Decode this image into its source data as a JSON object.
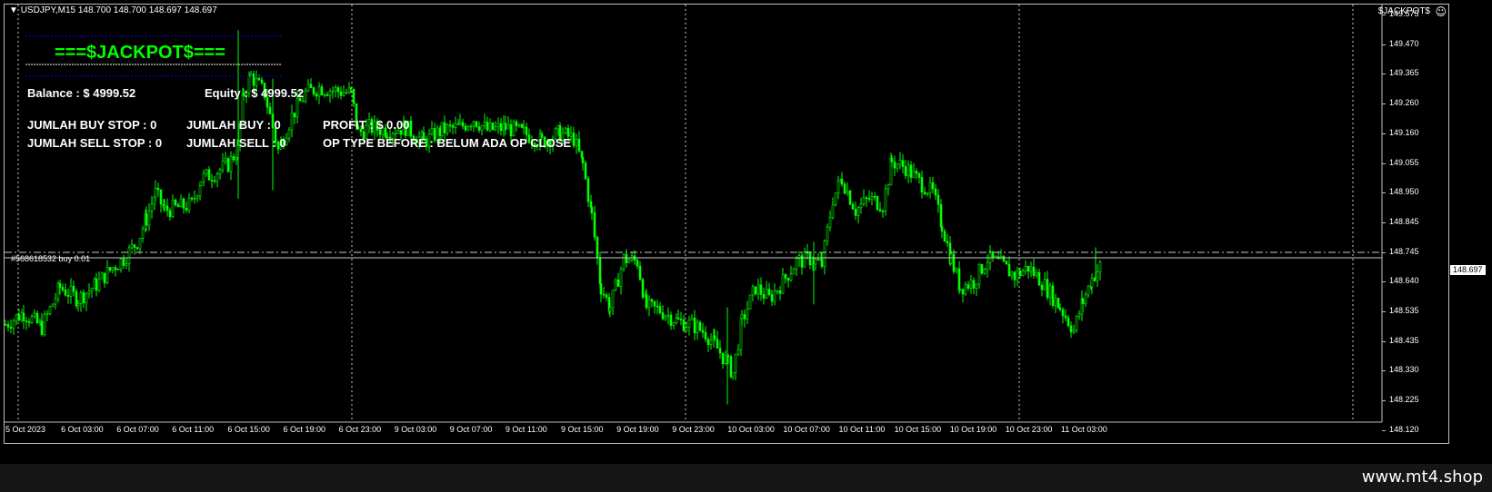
{
  "window": {
    "symbol_header": "USDJPY,M15  148.700 148.700 148.697 148.697",
    "ea_name": "$JACKPOT$",
    "smile_icon": "☺"
  },
  "panel": {
    "title": "===$JACKPOT$===",
    "balance": "Balance : $ 4999.52",
    "equity": "Equity : $ 4999.52",
    "buy_stop": "JUMLAH BUY STOP   : 0",
    "sell_stop": "JUMLAH SELL STOP : 0",
    "buy": "JUMLAH BUY   : 0",
    "sell": "JUMLAH SELL : 0",
    "profit": "PROFIT : $ 0.00",
    "op_type": "OP TYPE BEFORE : BELUM ADA OP CLOSE"
  },
  "order_line": {
    "label": "#568618532 buy 0.01"
  },
  "current_price": "148.697",
  "y_axis_labels": [
    "149.575",
    "149.470",
    "149.365",
    "149.260",
    "149.160",
    "149.055",
    "148.950",
    "148.845",
    "148.745",
    "148.640",
    "148.535",
    "148.435",
    "148.330",
    "148.225",
    "148.120"
  ],
  "x_axis_labels": [
    "5 Oct 2023",
    "6 Oct 03:00",
    "6 Oct 07:00",
    "6 Oct 11:00",
    "6 Oct 15:00",
    "6 Oct 19:00",
    "6 Oct 23:00",
    "9 Oct 03:00",
    "9 Oct 07:00",
    "9 Oct 11:00",
    "9 Oct 15:00",
    "9 Oct 19:00",
    "9 Oct 23:00",
    "10 Oct 03:00",
    "10 Oct 07:00",
    "10 Oct 11:00",
    "10 Oct 15:00",
    "10 Oct 19:00",
    "10 Oct 23:00",
    "11 Oct 03:00"
  ],
  "colors": {
    "background": "#000000",
    "candle": "#00ff00",
    "panel_title": "#00ff00",
    "panel_text": "#ffff00",
    "separator_blue": "#0000ff",
    "separator_white": "#ffffff"
  },
  "chart_data": {
    "type": "candlestick",
    "symbol": "USDJPY",
    "timeframe": "M15",
    "ylim": [
      148.12,
      149.575
    ],
    "close_path": [
      [
        0,
        148.49
      ],
      [
        20,
        148.53
      ],
      [
        40,
        148.48
      ],
      [
        60,
        148.62
      ],
      [
        80,
        148.58
      ],
      [
        100,
        148.63
      ],
      [
        118,
        148.69
      ],
      [
        130,
        148.72
      ],
      [
        145,
        148.78
      ],
      [
        155,
        148.86
      ],
      [
        165,
        148.95
      ],
      [
        175,
        148.89
      ],
      [
        190,
        148.9
      ],
      [
        205,
        148.91
      ],
      [
        215,
        149.0
      ],
      [
        230,
        149.02
      ],
      [
        245,
        149.05
      ],
      [
        255,
        149.1
      ],
      [
        262,
        149.3
      ],
      [
        270,
        149.36
      ],
      [
        285,
        149.3
      ],
      [
        300,
        149.1
      ],
      [
        315,
        149.22
      ],
      [
        330,
        149.3
      ],
      [
        345,
        149.32
      ],
      [
        360,
        149.31
      ],
      [
        380,
        149.3
      ],
      [
        388,
        149.16
      ],
      [
        400,
        149.18
      ],
      [
        420,
        149.17
      ],
      [
        440,
        149.18
      ],
      [
        460,
        149.13
      ],
      [
        480,
        149.17
      ],
      [
        500,
        149.18
      ],
      [
        515,
        149.21
      ],
      [
        530,
        149.17
      ],
      [
        550,
        149.18
      ],
      [
        570,
        149.16
      ],
      [
        590,
        149.13
      ],
      [
        610,
        149.16
      ],
      [
        625,
        149.14
      ],
      [
        635,
        149.05
      ],
      [
        645,
        148.87
      ],
      [
        655,
        148.62
      ],
      [
        665,
        148.55
      ],
      [
        680,
        148.72
      ],
      [
        695,
        148.71
      ],
      [
        705,
        148.55
      ],
      [
        720,
        148.54
      ],
      [
        740,
        148.5
      ],
      [
        755,
        148.49
      ],
      [
        770,
        148.46
      ],
      [
        780,
        148.42
      ],
      [
        795,
        148.35
      ],
      [
        800,
        148.32
      ],
      [
        810,
        148.5
      ],
      [
        825,
        148.62
      ],
      [
        840,
        148.58
      ],
      [
        855,
        148.64
      ],
      [
        870,
        148.71
      ],
      [
        885,
        148.72
      ],
      [
        898,
        148.7
      ],
      [
        910,
        148.93
      ],
      [
        920,
        149.0
      ],
      [
        935,
        148.89
      ],
      [
        950,
        148.93
      ],
      [
        965,
        148.91
      ],
      [
        975,
        149.06
      ],
      [
        990,
        149.04
      ],
      [
        1005,
        148.99
      ],
      [
        1020,
        148.95
      ],
      [
        1030,
        148.84
      ],
      [
        1040,
        148.72
      ],
      [
        1050,
        148.62
      ],
      [
        1065,
        148.64
      ],
      [
        1080,
        148.72
      ],
      [
        1095,
        148.7
      ],
      [
        1110,
        148.66
      ],
      [
        1125,
        148.69
      ],
      [
        1140,
        148.64
      ],
      [
        1160,
        148.55
      ],
      [
        1175,
        148.47
      ],
      [
        1185,
        148.57
      ],
      [
        1195,
        148.65
      ],
      [
        1205,
        148.697
      ]
    ]
  }
}
